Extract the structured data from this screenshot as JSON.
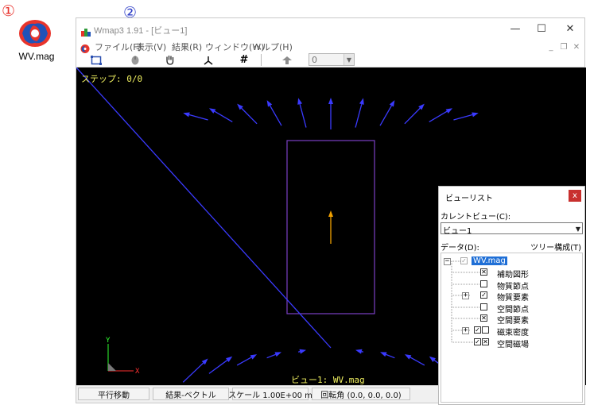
{
  "annotations": {
    "one": "①",
    "two": "②"
  },
  "desktop": {
    "icon_label": "WV.mag",
    "icon_name": "wv-mag-file-icon"
  },
  "window": {
    "title": "Wmap3 1.91 - [ビュー1]",
    "controls": {
      "minimize": "—",
      "maximize": "☐",
      "close": "✕"
    },
    "menu": {
      "file": "ファイル(F)",
      "view": "表示(V)",
      "result": "結果(R)",
      "window": "ウィンドウ(W)",
      "help": "ヘルプ(H)"
    },
    "mdi_controls": {
      "minimize": "_",
      "restore": "❐",
      "close": "✕"
    },
    "toolbar": {
      "icons": [
        "fit-view-icon",
        "rotate-mouse-icon",
        "pan-hand-icon",
        "axes-icon",
        "grid-hash-icon",
        "vector-icon"
      ],
      "hash_glyph": "#",
      "step_value": "0"
    },
    "canvas": {
      "step_text": "ステップ: 0/0",
      "caption": "ビュー1: WV.mag",
      "axis_y": "Y",
      "axis_x": "X",
      "colors": {
        "background": "#000000",
        "frame": "#7b3fc4",
        "vector": "#3a3aff",
        "center_vector": "#f0a000",
        "caption": "#f0f060",
        "axis_x": "#ff3030",
        "axis_y": "#30ff30"
      }
    },
    "status": {
      "mode": "平行移動",
      "result": "結果-ベクトル",
      "scale": "スケール 1.00E+00 m",
      "rotation": "回転角 (0.0, 0.0, 0.0)"
    }
  },
  "view_list": {
    "title": "ビューリスト",
    "close": "x",
    "current_view_label": "カレントビュー(C):",
    "current_view_value": "ビュー1",
    "data_label": "データ(D):",
    "tree_label": "ツリー構成(T)",
    "tree": [
      {
        "label": "WV.mag",
        "check": "✓",
        "expander": "−",
        "root": true
      },
      {
        "label": "補助図形",
        "check": "✕"
      },
      {
        "label": "物質節点",
        "check": ""
      },
      {
        "label": "物質要素",
        "check": "✓",
        "expander": "+"
      },
      {
        "label": "空間節点",
        "check": ""
      },
      {
        "label": "空間要素",
        "check": "✕"
      },
      {
        "label": "磁束密度",
        "check": "✓",
        "check2": "",
        "expander": "+"
      },
      {
        "label": "空間磁場",
        "check": "✓",
        "check2": "✕"
      }
    ]
  }
}
